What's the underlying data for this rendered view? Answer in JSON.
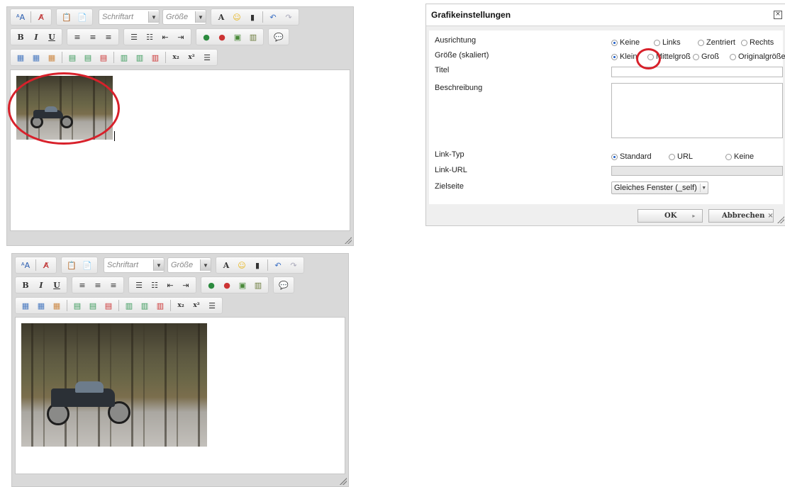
{
  "toolbar": {
    "font_label": "Schriftart",
    "size_label": "Größe",
    "font_color_glyph": "A",
    "bold": "B",
    "italic": "I",
    "underline": "U",
    "subscript": "x₂",
    "superscript": "x²"
  },
  "dialog": {
    "title": "Grafikeinstellungen",
    "close_glyph": "×",
    "rows": {
      "alignment_label": "Ausrichtung",
      "size_label": "Größe (skaliert)",
      "title_label": "Titel",
      "description_label": "Beschreibung",
      "link_type_label": "Link-Typ",
      "link_url_label": "Link-URL",
      "target_label": "Zielseite"
    },
    "alignment_options": [
      "Keine",
      "Links",
      "Zentriert",
      "Rechts"
    ],
    "alignment_selected": "Keine",
    "size_options": [
      "Klein",
      "Mittelgroß",
      "Groß",
      "Originalgröße"
    ],
    "size_selected": "Klein",
    "link_type_options": [
      "Standard",
      "URL",
      "Keine"
    ],
    "link_type_selected": "Standard",
    "target_value": "Gleiches Fenster (_self)",
    "ok_label": "OK",
    "ok_icon": "▸",
    "cancel_label": "Abbrechen",
    "cancel_icon": "×"
  },
  "colors": {
    "annotation_red": "#d8212b",
    "radio_selected": "#1a5bc9"
  },
  "icons": [
    "font-size-icon",
    "remove-format-icon",
    "paste-icon",
    "paste-word-icon",
    "font-color-icon",
    "smiley-icon",
    "media-icon",
    "undo-icon",
    "redo-icon",
    "align-left-icon",
    "align-center-icon",
    "align-right-icon",
    "ordered-list-icon",
    "unordered-list-icon",
    "outdent-icon",
    "indent-icon",
    "link-icon",
    "unlink-icon",
    "image-icon",
    "film-icon",
    "comment-icon",
    "table-icon",
    "table-props-icon",
    "cell-props-icon",
    "row-before-icon",
    "row-after-icon",
    "delete-row-icon",
    "col-before-icon",
    "col-after-icon",
    "delete-col-icon",
    "horizontal-rule-icon",
    "resize-grip-icon"
  ]
}
